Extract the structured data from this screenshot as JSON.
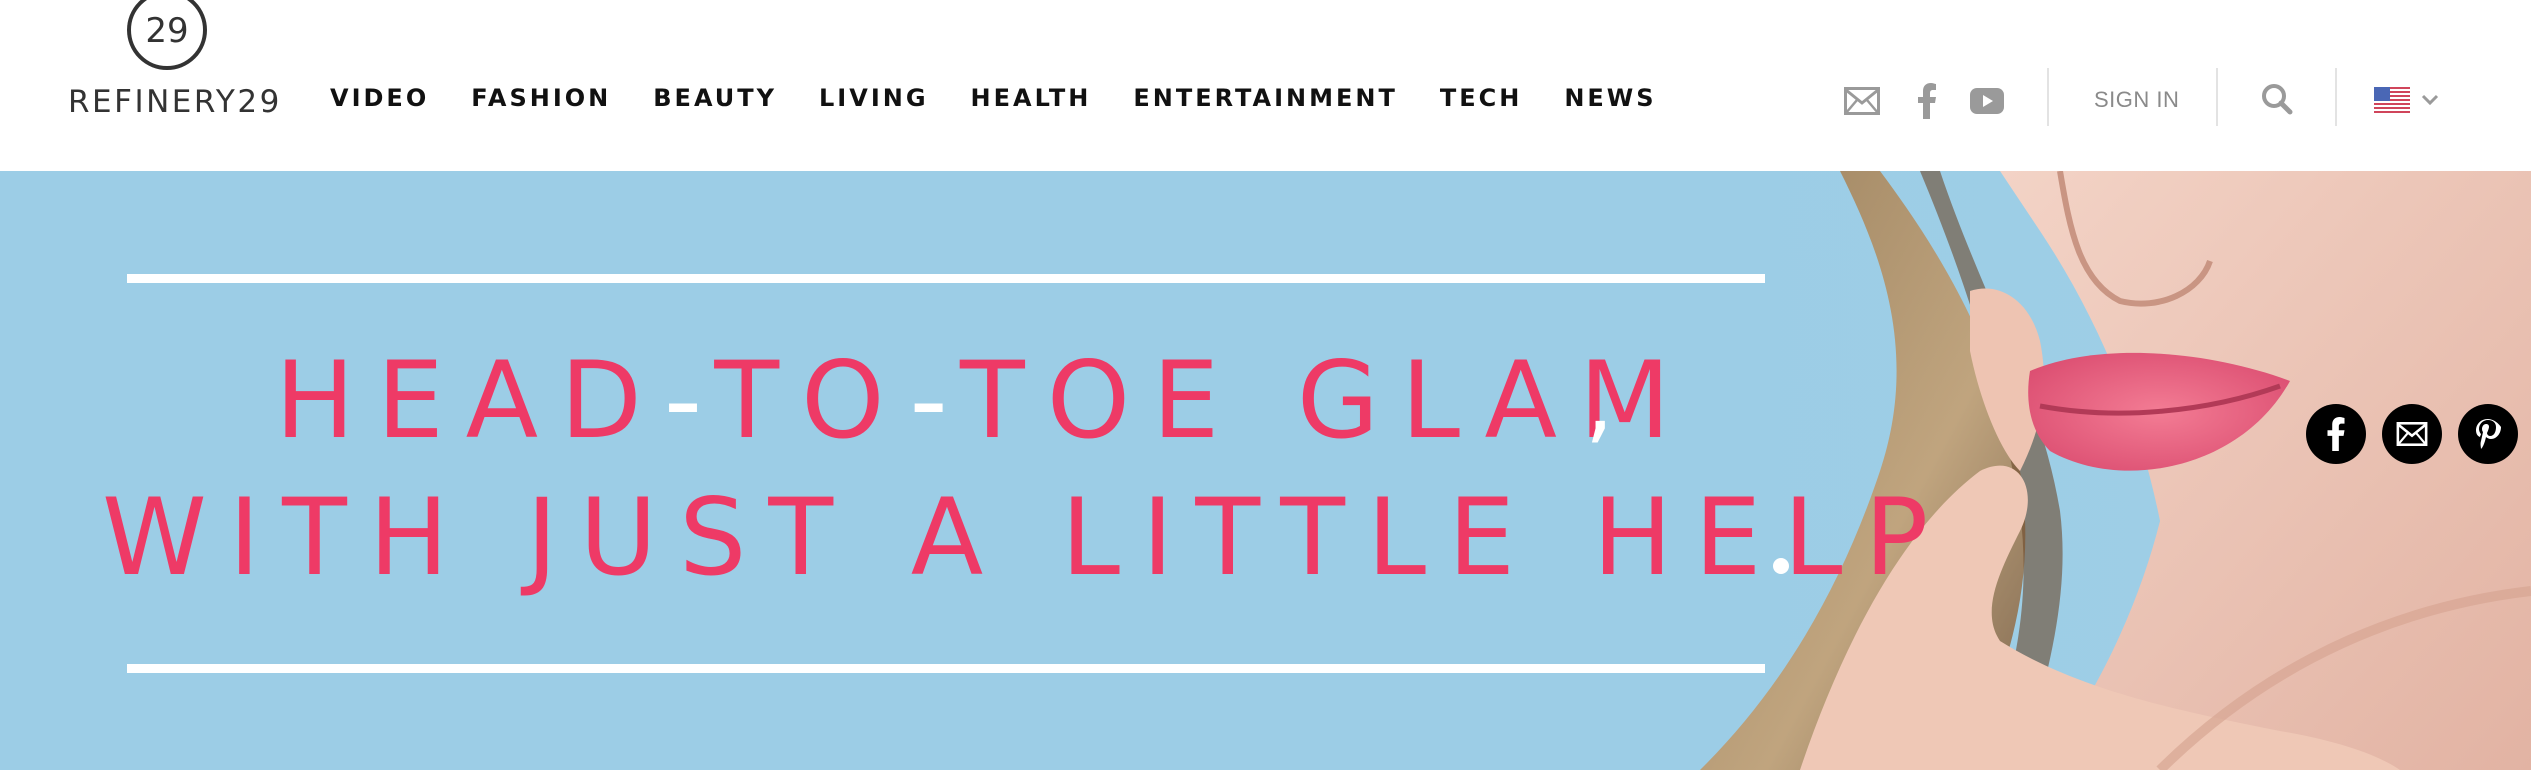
{
  "brand": {
    "name": "REFINERY29",
    "mark_text": "29"
  },
  "nav": {
    "items": [
      {
        "label": "VIDEO"
      },
      {
        "label": "FASHION"
      },
      {
        "label": "BEAUTY"
      },
      {
        "label": "LIVING"
      },
      {
        "label": "HEALTH"
      },
      {
        "label": "ENTERTAINMENT"
      },
      {
        "label": "TECH"
      },
      {
        "label": "NEWS"
      }
    ]
  },
  "toolbar": {
    "icons": [
      "mail-icon",
      "facebook-icon",
      "youtube-icon",
      "search-icon",
      "us-flag-icon",
      "chevron-down-icon"
    ],
    "signin_label": "SIGN IN"
  },
  "hero": {
    "line1_part1": "HEAD",
    "dash": "-",
    "line1_part2": "TO",
    "line1_part3": "TOE GLAM",
    "line2": "WITH JUST A LITTLE HELP",
    "accent_color": "#ee3a66",
    "background_color": "#9ccde6"
  },
  "share": {
    "icons": [
      "facebook-share-icon",
      "email-share-icon",
      "pinterest-share-icon"
    ]
  }
}
